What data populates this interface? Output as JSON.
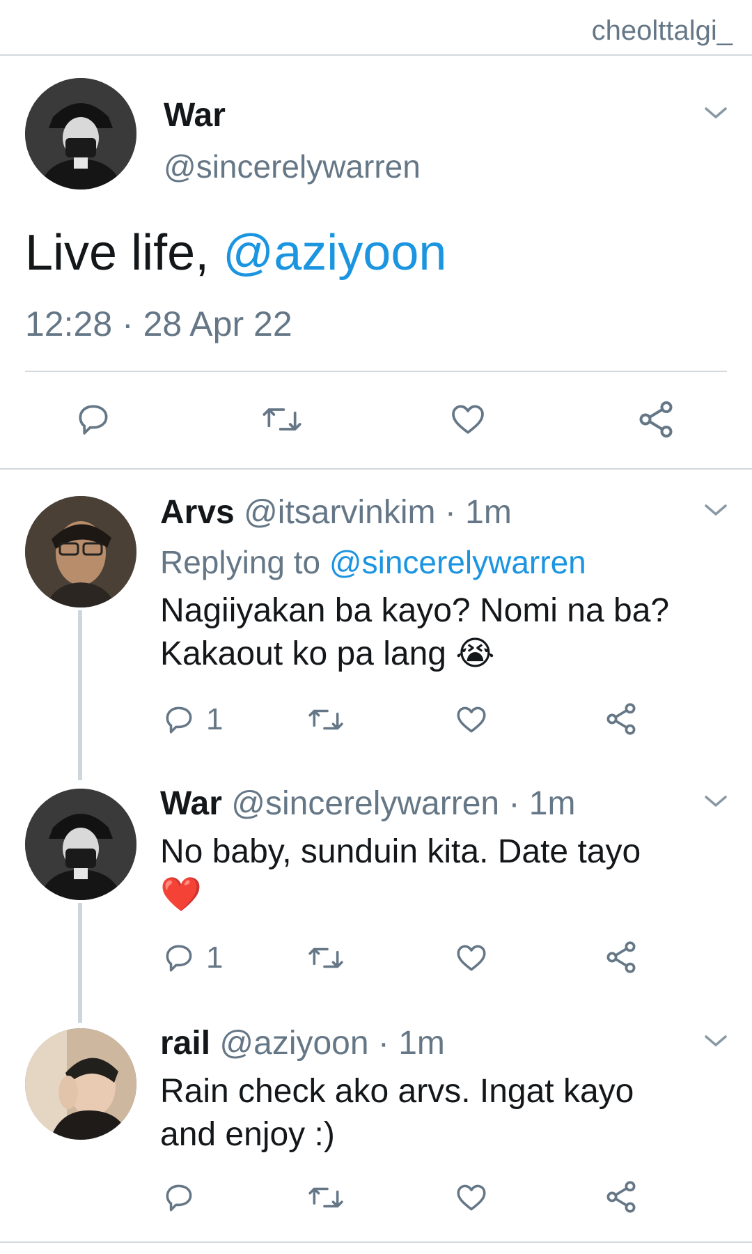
{
  "watermark": "cheolttalgi_",
  "main_tweet": {
    "name": "War",
    "handle": "@sincerelywarren",
    "text_prefix": "Live life, ",
    "mention": "@aziyoon",
    "time": "12:28",
    "separator": " · ",
    "date": "28 Apr 22",
    "icons": [
      "chevron-down-icon",
      "reply-icon",
      "retweet-icon",
      "like-icon",
      "share-icon"
    ]
  },
  "replies": [
    {
      "name": "Arvs",
      "handle": "@itsarvinkim",
      "time": "· 1m",
      "replying_prefix": "Replying to ",
      "replying_to": "@sincerelywarren",
      "text": "Nagiiyakan ba kayo? Nomi na ba?",
      "text2": "Kakaout ko pa lang 😭",
      "reply_count": "1"
    },
    {
      "name": "War",
      "handle": "@sincerelywarren",
      "time": "· 1m",
      "text": "No baby, sunduin kita. Date tayo",
      "text2": "❤️",
      "reply_count": "1"
    },
    {
      "name": "rail",
      "handle": "@aziyoon",
      "time": "· 1m",
      "text": "Rain check ako arvs. Ingat kayo",
      "text2": "and enjoy :)",
      "reply_count": ""
    }
  ],
  "colors": {
    "accent": "#1b95e0",
    "secondary_text": "#657786",
    "divider": "#d3d9de",
    "thread_line": "#ccd6dd"
  }
}
